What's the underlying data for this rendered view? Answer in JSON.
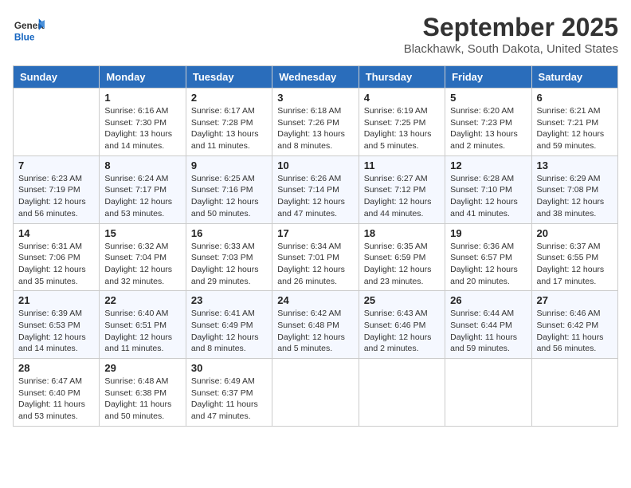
{
  "header": {
    "logo_line1": "General",
    "logo_line2": "Blue",
    "month": "September 2025",
    "location": "Blackhawk, South Dakota, United States"
  },
  "days_of_week": [
    "Sunday",
    "Monday",
    "Tuesday",
    "Wednesday",
    "Thursday",
    "Friday",
    "Saturday"
  ],
  "weeks": [
    [
      {
        "day": "",
        "info": ""
      },
      {
        "day": "1",
        "info": "Sunrise: 6:16 AM\nSunset: 7:30 PM\nDaylight: 13 hours\nand 14 minutes."
      },
      {
        "day": "2",
        "info": "Sunrise: 6:17 AM\nSunset: 7:28 PM\nDaylight: 13 hours\nand 11 minutes."
      },
      {
        "day": "3",
        "info": "Sunrise: 6:18 AM\nSunset: 7:26 PM\nDaylight: 13 hours\nand 8 minutes."
      },
      {
        "day": "4",
        "info": "Sunrise: 6:19 AM\nSunset: 7:25 PM\nDaylight: 13 hours\nand 5 minutes."
      },
      {
        "day": "5",
        "info": "Sunrise: 6:20 AM\nSunset: 7:23 PM\nDaylight: 13 hours\nand 2 minutes."
      },
      {
        "day": "6",
        "info": "Sunrise: 6:21 AM\nSunset: 7:21 PM\nDaylight: 12 hours\nand 59 minutes."
      }
    ],
    [
      {
        "day": "7",
        "info": "Sunrise: 6:23 AM\nSunset: 7:19 PM\nDaylight: 12 hours\nand 56 minutes."
      },
      {
        "day": "8",
        "info": "Sunrise: 6:24 AM\nSunset: 7:17 PM\nDaylight: 12 hours\nand 53 minutes."
      },
      {
        "day": "9",
        "info": "Sunrise: 6:25 AM\nSunset: 7:16 PM\nDaylight: 12 hours\nand 50 minutes."
      },
      {
        "day": "10",
        "info": "Sunrise: 6:26 AM\nSunset: 7:14 PM\nDaylight: 12 hours\nand 47 minutes."
      },
      {
        "day": "11",
        "info": "Sunrise: 6:27 AM\nSunset: 7:12 PM\nDaylight: 12 hours\nand 44 minutes."
      },
      {
        "day": "12",
        "info": "Sunrise: 6:28 AM\nSunset: 7:10 PM\nDaylight: 12 hours\nand 41 minutes."
      },
      {
        "day": "13",
        "info": "Sunrise: 6:29 AM\nSunset: 7:08 PM\nDaylight: 12 hours\nand 38 minutes."
      }
    ],
    [
      {
        "day": "14",
        "info": "Sunrise: 6:31 AM\nSunset: 7:06 PM\nDaylight: 12 hours\nand 35 minutes."
      },
      {
        "day": "15",
        "info": "Sunrise: 6:32 AM\nSunset: 7:04 PM\nDaylight: 12 hours\nand 32 minutes."
      },
      {
        "day": "16",
        "info": "Sunrise: 6:33 AM\nSunset: 7:03 PM\nDaylight: 12 hours\nand 29 minutes."
      },
      {
        "day": "17",
        "info": "Sunrise: 6:34 AM\nSunset: 7:01 PM\nDaylight: 12 hours\nand 26 minutes."
      },
      {
        "day": "18",
        "info": "Sunrise: 6:35 AM\nSunset: 6:59 PM\nDaylight: 12 hours\nand 23 minutes."
      },
      {
        "day": "19",
        "info": "Sunrise: 6:36 AM\nSunset: 6:57 PM\nDaylight: 12 hours\nand 20 minutes."
      },
      {
        "day": "20",
        "info": "Sunrise: 6:37 AM\nSunset: 6:55 PM\nDaylight: 12 hours\nand 17 minutes."
      }
    ],
    [
      {
        "day": "21",
        "info": "Sunrise: 6:39 AM\nSunset: 6:53 PM\nDaylight: 12 hours\nand 14 minutes."
      },
      {
        "day": "22",
        "info": "Sunrise: 6:40 AM\nSunset: 6:51 PM\nDaylight: 12 hours\nand 11 minutes."
      },
      {
        "day": "23",
        "info": "Sunrise: 6:41 AM\nSunset: 6:49 PM\nDaylight: 12 hours\nand 8 minutes."
      },
      {
        "day": "24",
        "info": "Sunrise: 6:42 AM\nSunset: 6:48 PM\nDaylight: 12 hours\nand 5 minutes."
      },
      {
        "day": "25",
        "info": "Sunrise: 6:43 AM\nSunset: 6:46 PM\nDaylight: 12 hours\nand 2 minutes."
      },
      {
        "day": "26",
        "info": "Sunrise: 6:44 AM\nSunset: 6:44 PM\nDaylight: 11 hours\nand 59 minutes."
      },
      {
        "day": "27",
        "info": "Sunrise: 6:46 AM\nSunset: 6:42 PM\nDaylight: 11 hours\nand 56 minutes."
      }
    ],
    [
      {
        "day": "28",
        "info": "Sunrise: 6:47 AM\nSunset: 6:40 PM\nDaylight: 11 hours\nand 53 minutes."
      },
      {
        "day": "29",
        "info": "Sunrise: 6:48 AM\nSunset: 6:38 PM\nDaylight: 11 hours\nand 50 minutes."
      },
      {
        "day": "30",
        "info": "Sunrise: 6:49 AM\nSunset: 6:37 PM\nDaylight: 11 hours\nand 47 minutes."
      },
      {
        "day": "",
        "info": ""
      },
      {
        "day": "",
        "info": ""
      },
      {
        "day": "",
        "info": ""
      },
      {
        "day": "",
        "info": ""
      }
    ]
  ]
}
